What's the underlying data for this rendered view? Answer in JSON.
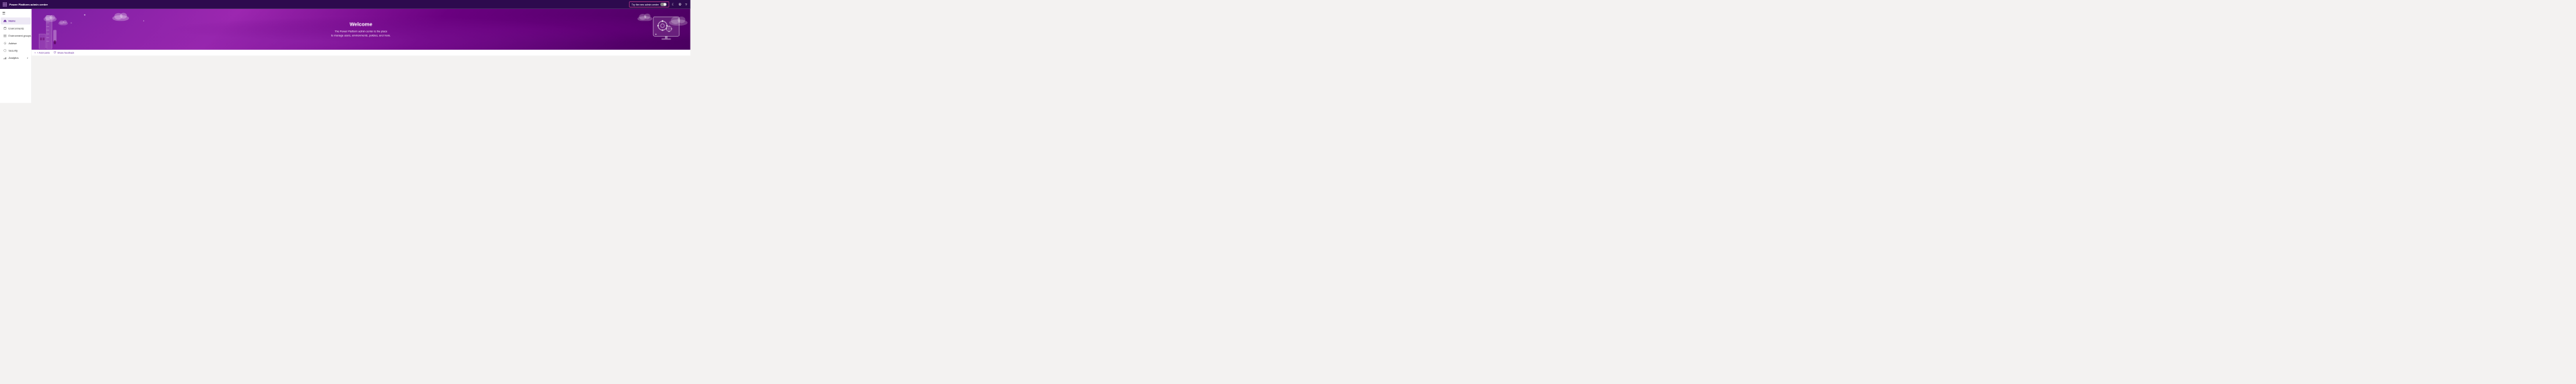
{
  "app": {
    "title": "Power Platform admin center"
  },
  "topbar": {
    "brand_label": "Power Platform admin center",
    "try_new_label": "Try the new admin center",
    "moon_icon": "☾",
    "settings_icon": "⚙",
    "help_icon": "?"
  },
  "sidebar": {
    "hamburger": "☰",
    "items": [
      {
        "id": "home",
        "label": "Home",
        "icon": "home",
        "active": true
      },
      {
        "id": "environments",
        "label": "Environments",
        "icon": "environments",
        "active": false
      },
      {
        "id": "environment-groups",
        "label": "Environment groups",
        "icon": "env-groups",
        "active": false
      },
      {
        "id": "advisor",
        "label": "Advisor",
        "icon": "advisor",
        "active": false
      },
      {
        "id": "security",
        "label": "Security",
        "icon": "security",
        "active": false
      },
      {
        "id": "analytics",
        "label": "Analytics",
        "icon": "analytics",
        "active": false,
        "hasChevron": true
      }
    ]
  },
  "banner": {
    "title": "Welcome",
    "subtitle_line1": "The Power Platform admin center is the place",
    "subtitle_line2": "to manage users, environments, policies, and more."
  },
  "toolbar": {
    "add_cards_label": "+ Add cards",
    "share_feedback_label": "Share feedback"
  },
  "colors": {
    "accent": "#6b2fa0",
    "banner_bg": "#7b1fa2",
    "try_border": "#e74c9a"
  }
}
